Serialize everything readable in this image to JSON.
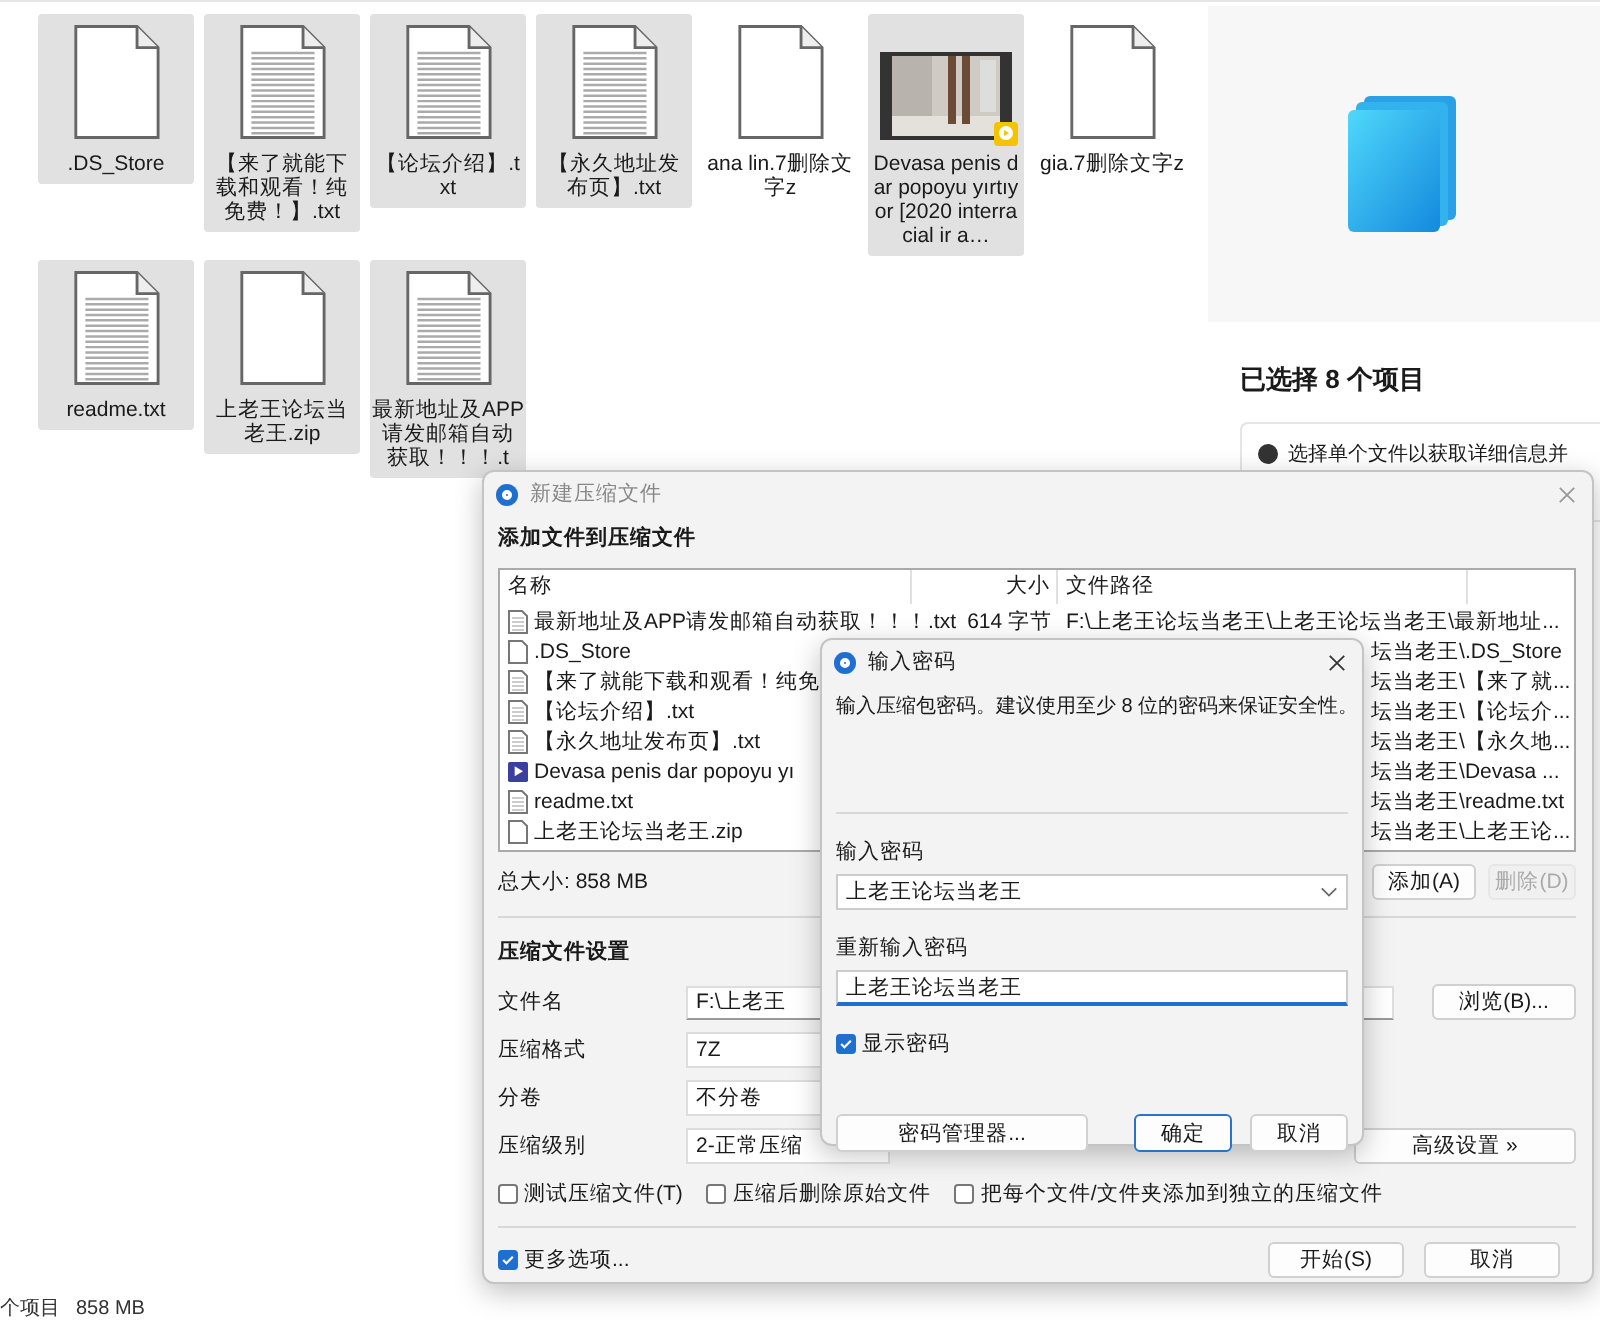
{
  "explorer": {
    "files": [
      {
        "name": ".DS_Store",
        "kind": "blank",
        "selected": true
      },
      {
        "name": "【来了就能下载和观看！纯免费！】.txt",
        "kind": "text",
        "selected": true
      },
      {
        "name": "【论坛介绍】.txt",
        "kind": "text",
        "selected": true
      },
      {
        "name": "【永久地址发布页】.txt",
        "kind": "text",
        "selected": true
      },
      {
        "name": "ana lin.7删除文字z",
        "kind": "blank",
        "selected": false
      },
      {
        "name": "Devasa penis dar popoyu yırtıyor [2020 interracial ir a…",
        "kind": "video",
        "selected": true
      },
      {
        "name": "gia.7删除文字z",
        "kind": "blank",
        "selected": false
      },
      {
        "name": "readme.txt",
        "kind": "text",
        "selected": true
      },
      {
        "name": "上老王论坛当老王.zip",
        "kind": "blank",
        "selected": true
      },
      {
        "name": "最新地址及APP请发邮箱自动获取！！！.t",
        "kind": "text",
        "selected": true
      }
    ],
    "details": {
      "heading": "已选择 8 个项目",
      "hint": "选择单个文件以获取详细信息并"
    },
    "status": {
      "count": "个项目",
      "size": "858 MB"
    }
  },
  "archive_dialog": {
    "title": "新建压缩文件",
    "section": "添加文件到压缩文件",
    "columns": [
      "名称",
      "大小",
      "文件路径"
    ],
    "rows": [
      {
        "name": "最新地址及APP请发邮箱自动获取！！！.txt",
        "kind": "text",
        "size": "614 字节",
        "path": "F:\\上老王论坛当老王\\上老王论坛当老王\\最新地址..."
      },
      {
        "name": ".DS_Store",
        "kind": "blank",
        "path": "坛当老王\\.DS_Store"
      },
      {
        "name": "【来了就能下载和观看！纯免",
        "kind": "text",
        "path": "坛当老王\\【来了就..."
      },
      {
        "name": "【论坛介绍】.txt",
        "kind": "text",
        "path": "坛当老王\\【论坛介..."
      },
      {
        "name": "【永久地址发布页】.txt",
        "kind": "text",
        "path": "坛当老王\\【永久地..."
      },
      {
        "name": "Devasa penis dar popoyu yı",
        "kind": "video",
        "path": "坛当老王\\Devasa ..."
      },
      {
        "name": "readme.txt",
        "kind": "text",
        "path": "坛当老王\\readme.txt"
      },
      {
        "name": "上老王论坛当老王.zip",
        "kind": "blank",
        "path": "坛当老王\\上老王论..."
      }
    ],
    "total": "总大小: 858 MB",
    "list_buttons": [
      {
        "label": "添加(A)",
        "disabled": false
      },
      {
        "label": "删除(D)",
        "disabled": true
      }
    ],
    "settings_heading": "压缩文件设置",
    "fields": [
      {
        "label": "文件名",
        "value": "F:\\上老王",
        "kind": "text"
      },
      {
        "label": "压缩格式",
        "value": "7Z",
        "kind": "box"
      },
      {
        "label": "分卷",
        "value": "不分卷",
        "kind": "box"
      },
      {
        "label": "压缩级别",
        "value": "2-正常压缩",
        "kind": "select"
      }
    ],
    "browse_button": "浏览(B)...",
    "advanced_button": "高级设置 »",
    "options": [
      {
        "label": "测试压缩文件(T)",
        "checked": false
      },
      {
        "label": "压缩后删除原始文件",
        "checked": false
      },
      {
        "label": "把每个文件/文件夹添加到独立的压缩文件",
        "checked": false
      }
    ],
    "more_options": {
      "label": "更多选项...",
      "checked": true
    },
    "buttons": [
      "开始(S)",
      "取消"
    ]
  },
  "password_dialog": {
    "title": "输入密码",
    "description": "输入压缩包密码。建议使用至少 8 位的密码来保证安全性。",
    "password_label": "输入密码",
    "password": "上老王论坛当老王",
    "repeat_label": "重新输入密码",
    "repeat": "上老王论坛当老王",
    "show_password": {
      "label": "显示密码",
      "checked": true
    },
    "manager_button": "密码管理器...",
    "ok_button": "确定",
    "cancel_button": "取消"
  }
}
